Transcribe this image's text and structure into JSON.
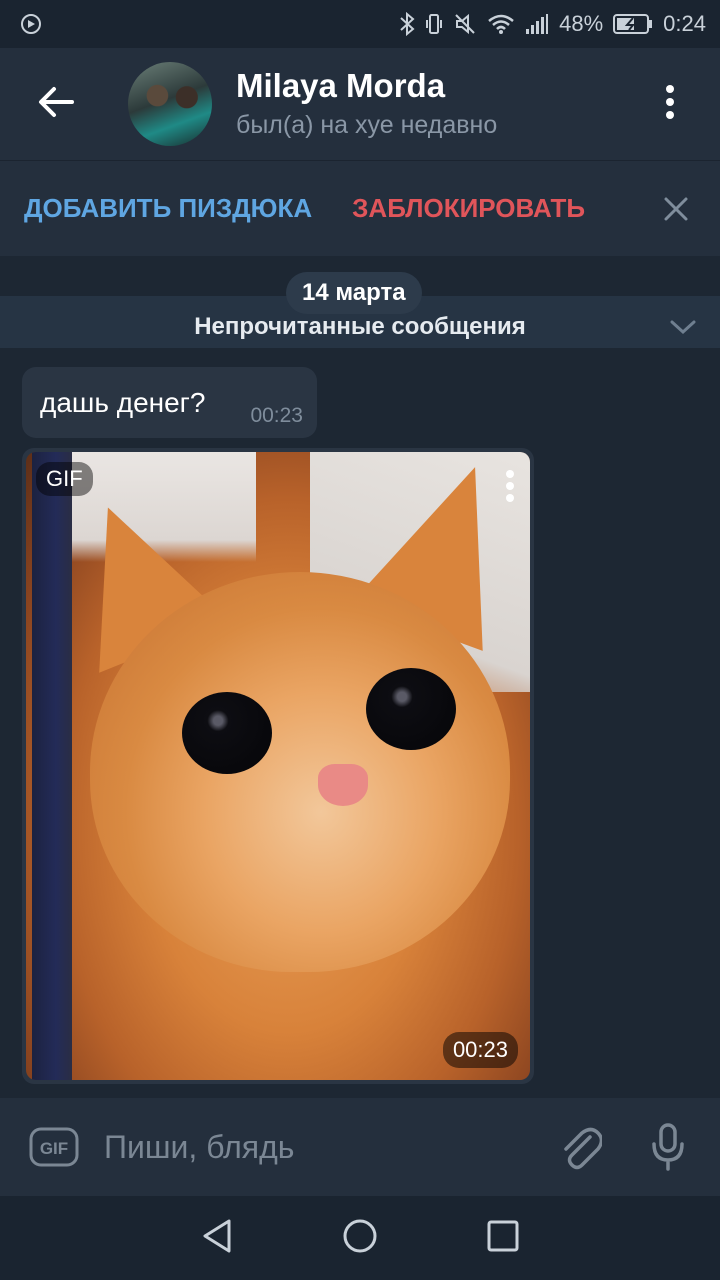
{
  "status_bar": {
    "battery": "48%",
    "time": "0:24",
    "icons": [
      "app-notification-icon",
      "bluetooth-icon",
      "vibrate-icon",
      "mute-icon",
      "wifi-icon",
      "signal-icon",
      "battery-icon"
    ]
  },
  "header": {
    "contact_name": "Milaya Morda",
    "status": "был(а) на хуе недавно",
    "icons": [
      "back-arrow-icon",
      "avatar",
      "more-vert-icon"
    ]
  },
  "action_bar": {
    "add_label": "ДОБАВИТЬ ПИЗДЮКА",
    "block_label": "ЗАБЛОКИРОВАТЬ",
    "colors": {
      "add": "#5fa6e2",
      "block": "#e0555a"
    }
  },
  "chat": {
    "date": "14 марта",
    "unread_label": "Непрочитанные сообщения",
    "messages": [
      {
        "type": "text",
        "text": "дашь денег?",
        "time": "00:23"
      },
      {
        "type": "gif",
        "badge": "GIF",
        "duration": "00:23"
      }
    ]
  },
  "composer": {
    "placeholder": "Пиши, блядь",
    "icons": [
      "gif-icon",
      "attach-icon",
      "mic-icon"
    ]
  },
  "nav": {
    "icons": [
      "back-triangle-icon",
      "home-circle-icon",
      "recents-square-icon"
    ]
  },
  "colors": {
    "background": "#1d2733",
    "header": "#242f3d",
    "bubble": "#2a3543",
    "unread_bar": "#263444"
  }
}
